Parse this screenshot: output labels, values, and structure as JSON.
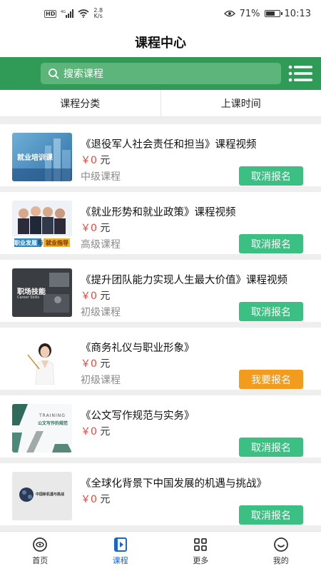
{
  "status_bar": {
    "hd": "HD",
    "network": "4G",
    "speed_value": "2.8",
    "speed_unit": "K/s",
    "battery": "71%",
    "battery_level": 0.71,
    "time": "10:13"
  },
  "header": {
    "title": "课程中心"
  },
  "search": {
    "placeholder": "搜索课程"
  },
  "filters": [
    {
      "label": "课程分类"
    },
    {
      "label": "上课时间"
    }
  ],
  "courses": [
    {
      "title": "《退役军人社会责任和担当》课程视频",
      "currency": "￥",
      "price": "0",
      "unit": "元",
      "level": "中级课程",
      "action": "取消报名",
      "action_state": "cancel",
      "thumb_text": "就业培训课"
    },
    {
      "title": "《就业形势和就业政策》课程视频",
      "currency": "￥",
      "price": "0",
      "unit": "元",
      "level": "高级课程",
      "action": "取消报名",
      "action_state": "cancel",
      "thumb_text_a": "职业发展",
      "thumb_text_b": "与",
      "thumb_text_c": "就业指导"
    },
    {
      "title": "《提升团队能力实现人生最大价值》课程视频",
      "currency": "￥",
      "price": "0",
      "unit": "元",
      "level": "初级课程",
      "action": "取消报名",
      "action_state": "cancel",
      "thumb_text": "职场技能",
      "thumb_sub": "Career Skills"
    },
    {
      "title": "《商务礼仪与职业形象》",
      "currency": "￥",
      "price": "0",
      "unit": "元",
      "level": "初级课程",
      "action": "我要报名",
      "action_state": "enroll"
    },
    {
      "title": "《公文写作规范与实务》",
      "currency": "￥",
      "price": "0",
      "unit": "元",
      "level": "",
      "action": "取消报名",
      "action_state": "cancel",
      "thumb_text": "TRAINING",
      "thumb_sub": "公文写作的规范"
    },
    {
      "title": "《全球化背景下中国发展的机遇与挑战》",
      "currency": "￥",
      "price": "0",
      "unit": "元",
      "level": "",
      "action": "取消报名",
      "action_state": "cancel",
      "thumb_text": "中国新机遇与挑战"
    }
  ],
  "tabbar": [
    {
      "label": "首页",
      "icon": "eye-icon",
      "active": false
    },
    {
      "label": "课程",
      "icon": "course-play-icon",
      "active": true
    },
    {
      "label": "更多",
      "icon": "grid-icon",
      "active": false
    },
    {
      "label": "我的",
      "icon": "smile-icon",
      "active": false
    }
  ],
  "colors": {
    "brand_green": "#2f9b56",
    "cancel_button": "#3cbf82",
    "enroll_button": "#f29b1c",
    "price_red": "#e24a3b",
    "tab_active": "#1a67c6"
  }
}
